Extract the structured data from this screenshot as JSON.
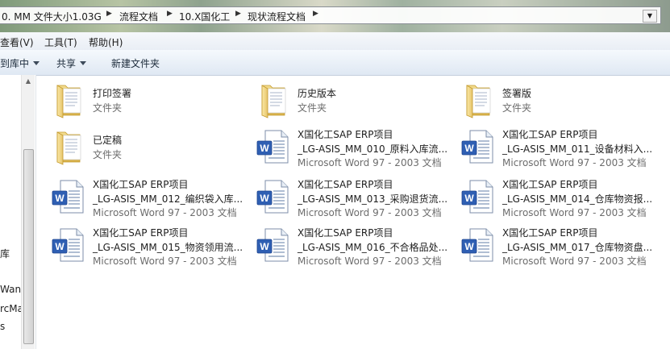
{
  "address": {
    "crumbs": [
      "0. MM 文件大小1.03G",
      "流程文档",
      "10.X国化工",
      "现状流程文档"
    ]
  },
  "menu": {
    "view": "查看(V)",
    "tools": "工具(T)",
    "help": "帮助(H)"
  },
  "toolbar": {
    "include_library": "到库中",
    "share": "共享",
    "new_folder": "新建文件夹"
  },
  "nav": {
    "items": [
      "库",
      "Wan",
      "rcMa",
      "s"
    ]
  },
  "files": [
    {
      "icon": "folder",
      "name": "打印签署",
      "type": "文件夹"
    },
    {
      "icon": "folder",
      "name": "历史版本",
      "type": "文件夹"
    },
    {
      "icon": "folder",
      "name": "签署版",
      "type": "文件夹"
    },
    {
      "icon": "folder",
      "name": "已定稿",
      "type": "文件夹"
    },
    {
      "icon": "word-doc",
      "name1": "X国化工SAP ERP项目",
      "name2": "_LG-ASIS_MM_010_原料入库流...",
      "type": "Microsoft Word 97 - 2003 文档"
    },
    {
      "icon": "word-doc",
      "name1": "X国化工SAP ERP项目",
      "name2": "_LG-ASIS_MM_011_设备材料入...",
      "type": "Microsoft Word 97 - 2003 文档"
    },
    {
      "icon": "word-doc",
      "name1": "X国化工SAP ERP项目",
      "name2": "_LG-ASIS_MM_012_编织袋入库...",
      "type": "Microsoft Word 97 - 2003 文档"
    },
    {
      "icon": "word-doc",
      "name1": "X国化工SAP ERP项目",
      "name2": "_LG-ASIS_MM_013_采购退货流...",
      "type": "Microsoft Word 97 - 2003 文档"
    },
    {
      "icon": "word-doc",
      "name1": "X国化工SAP ERP项目",
      "name2": "_LG-ASIS_MM_014_仓库物资报...",
      "type": "Microsoft Word 97 - 2003 文档"
    },
    {
      "icon": "word-doc",
      "name1": "X国化工SAP ERP项目",
      "name2": "_LG-ASIS_MM_015_物资领用流...",
      "type": "Microsoft Word 97 - 2003 文档"
    },
    {
      "icon": "word-doc",
      "name1": "X国化工SAP ERP项目",
      "name2": "_LG-ASIS_MM_016_不合格品处...",
      "type": "Microsoft Word 97 - 2003 文档"
    },
    {
      "icon": "word-doc",
      "name1": "X国化工SAP ERP项目",
      "name2": "_LG-ASIS_MM_017_仓库物资盘...",
      "type": "Microsoft Word 97 - 2003 文档"
    }
  ]
}
